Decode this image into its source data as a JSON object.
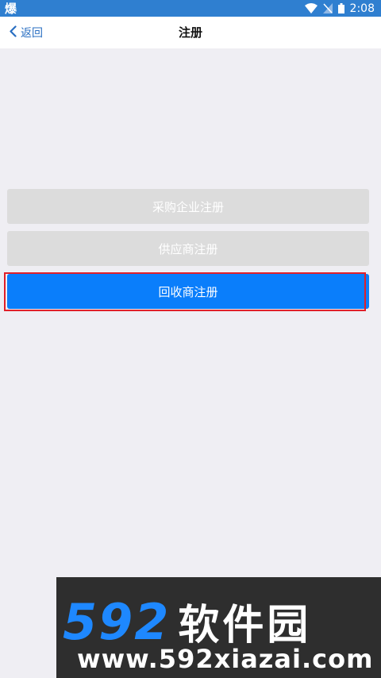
{
  "status_bar": {
    "left_glyph": "爆",
    "time": "2:08"
  },
  "nav": {
    "back_label": "返回",
    "title": "注册"
  },
  "buttons": {
    "purchase_enterprise": "采购企业注册",
    "supplier": "供应商注册",
    "recycler": "回收商注册"
  },
  "watermark": {
    "logo_number": "592",
    "logo_text": "软件园",
    "url": "www.592xiazai.com"
  },
  "colors": {
    "status_bar": "#2f7fd0",
    "accent_blue": "#0a7efb",
    "disabled_gray": "#dcdcdc",
    "highlight_red": "#e0202a",
    "background": "#efeef3"
  }
}
